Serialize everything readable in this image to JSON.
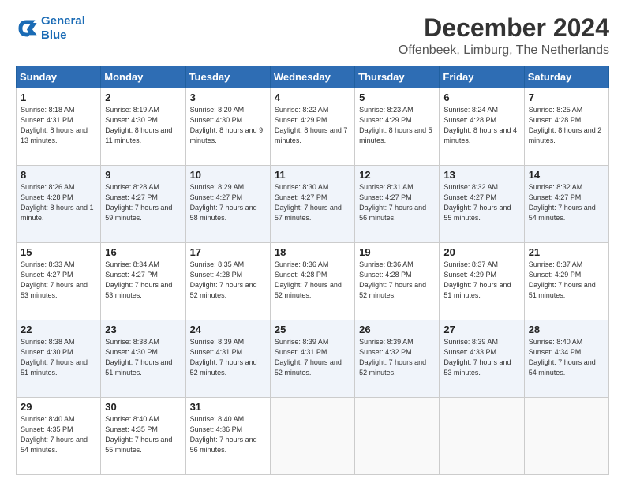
{
  "header": {
    "logo_line1": "General",
    "logo_line2": "Blue",
    "title": "December 2024",
    "subtitle": "Offenbeek, Limburg, The Netherlands"
  },
  "calendar": {
    "days_of_week": [
      "Sunday",
      "Monday",
      "Tuesday",
      "Wednesday",
      "Thursday",
      "Friday",
      "Saturday"
    ],
    "weeks": [
      [
        {
          "num": "1",
          "sunrise": "8:18 AM",
          "sunset": "4:31 PM",
          "daylight": "8 hours and 13 minutes."
        },
        {
          "num": "2",
          "sunrise": "8:19 AM",
          "sunset": "4:30 PM",
          "daylight": "8 hours and 11 minutes."
        },
        {
          "num": "3",
          "sunrise": "8:20 AM",
          "sunset": "4:30 PM",
          "daylight": "8 hours and 9 minutes."
        },
        {
          "num": "4",
          "sunrise": "8:22 AM",
          "sunset": "4:29 PM",
          "daylight": "8 hours and 7 minutes."
        },
        {
          "num": "5",
          "sunrise": "8:23 AM",
          "sunset": "4:29 PM",
          "daylight": "8 hours and 5 minutes."
        },
        {
          "num": "6",
          "sunrise": "8:24 AM",
          "sunset": "4:28 PM",
          "daylight": "8 hours and 4 minutes."
        },
        {
          "num": "7",
          "sunrise": "8:25 AM",
          "sunset": "4:28 PM",
          "daylight": "8 hours and 2 minutes."
        }
      ],
      [
        {
          "num": "8",
          "sunrise": "8:26 AM",
          "sunset": "4:28 PM",
          "daylight": "8 hours and 1 minute."
        },
        {
          "num": "9",
          "sunrise": "8:28 AM",
          "sunset": "4:27 PM",
          "daylight": "7 hours and 59 minutes."
        },
        {
          "num": "10",
          "sunrise": "8:29 AM",
          "sunset": "4:27 PM",
          "daylight": "7 hours and 58 minutes."
        },
        {
          "num": "11",
          "sunrise": "8:30 AM",
          "sunset": "4:27 PM",
          "daylight": "7 hours and 57 minutes."
        },
        {
          "num": "12",
          "sunrise": "8:31 AM",
          "sunset": "4:27 PM",
          "daylight": "7 hours and 56 minutes."
        },
        {
          "num": "13",
          "sunrise": "8:32 AM",
          "sunset": "4:27 PM",
          "daylight": "7 hours and 55 minutes."
        },
        {
          "num": "14",
          "sunrise": "8:32 AM",
          "sunset": "4:27 PM",
          "daylight": "7 hours and 54 minutes."
        }
      ],
      [
        {
          "num": "15",
          "sunrise": "8:33 AM",
          "sunset": "4:27 PM",
          "daylight": "7 hours and 53 minutes."
        },
        {
          "num": "16",
          "sunrise": "8:34 AM",
          "sunset": "4:27 PM",
          "daylight": "7 hours and 53 minutes."
        },
        {
          "num": "17",
          "sunrise": "8:35 AM",
          "sunset": "4:28 PM",
          "daylight": "7 hours and 52 minutes."
        },
        {
          "num": "18",
          "sunrise": "8:36 AM",
          "sunset": "4:28 PM",
          "daylight": "7 hours and 52 minutes."
        },
        {
          "num": "19",
          "sunrise": "8:36 AM",
          "sunset": "4:28 PM",
          "daylight": "7 hours and 52 minutes."
        },
        {
          "num": "20",
          "sunrise": "8:37 AM",
          "sunset": "4:29 PM",
          "daylight": "7 hours and 51 minutes."
        },
        {
          "num": "21",
          "sunrise": "8:37 AM",
          "sunset": "4:29 PM",
          "daylight": "7 hours and 51 minutes."
        }
      ],
      [
        {
          "num": "22",
          "sunrise": "8:38 AM",
          "sunset": "4:30 PM",
          "daylight": "7 hours and 51 minutes."
        },
        {
          "num": "23",
          "sunrise": "8:38 AM",
          "sunset": "4:30 PM",
          "daylight": "7 hours and 51 minutes."
        },
        {
          "num": "24",
          "sunrise": "8:39 AM",
          "sunset": "4:31 PM",
          "daylight": "7 hours and 52 minutes."
        },
        {
          "num": "25",
          "sunrise": "8:39 AM",
          "sunset": "4:31 PM",
          "daylight": "7 hours and 52 minutes."
        },
        {
          "num": "26",
          "sunrise": "8:39 AM",
          "sunset": "4:32 PM",
          "daylight": "7 hours and 52 minutes."
        },
        {
          "num": "27",
          "sunrise": "8:39 AM",
          "sunset": "4:33 PM",
          "daylight": "7 hours and 53 minutes."
        },
        {
          "num": "28",
          "sunrise": "8:40 AM",
          "sunset": "4:34 PM",
          "daylight": "7 hours and 54 minutes."
        }
      ],
      [
        {
          "num": "29",
          "sunrise": "8:40 AM",
          "sunset": "4:35 PM",
          "daylight": "7 hours and 54 minutes."
        },
        {
          "num": "30",
          "sunrise": "8:40 AM",
          "sunset": "4:35 PM",
          "daylight": "7 hours and 55 minutes."
        },
        {
          "num": "31",
          "sunrise": "8:40 AM",
          "sunset": "4:36 PM",
          "daylight": "7 hours and 56 minutes."
        },
        null,
        null,
        null,
        null
      ]
    ]
  }
}
